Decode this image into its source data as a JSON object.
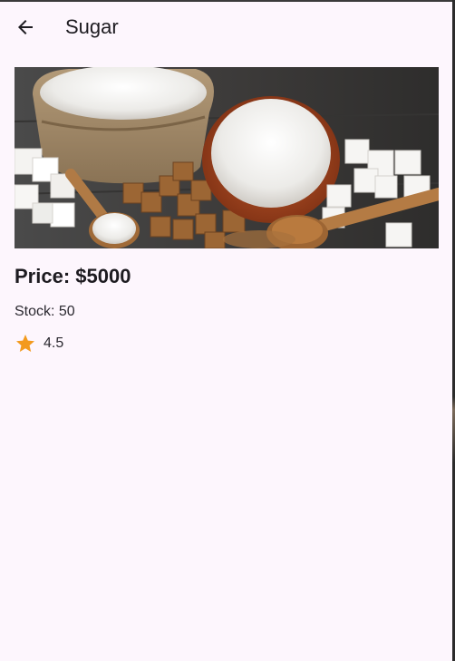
{
  "app_bar": {
    "title": "Sugar",
    "back_icon": "arrow-back-icon"
  },
  "product": {
    "image_icon": "sugar-product-photo",
    "price": "Price: $5000",
    "stock": "Stock: 50",
    "rating": "4.5",
    "rating_icon": "star-icon"
  },
  "colors": {
    "background": "#fdf6fd",
    "text": "#1d1b20",
    "star": "#f39a1d"
  }
}
